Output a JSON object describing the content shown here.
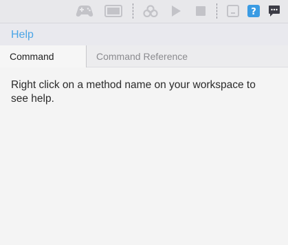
{
  "toolbar": {
    "icons": [
      "gamepad-icon",
      "window-icon",
      "blocks-icon",
      "play-icon",
      "stop-icon",
      "panel-icon",
      "help-icon",
      "chat-icon"
    ],
    "colors": {
      "disabled": "#c3c3c8",
      "active_blue": "#3b9be3",
      "dark": "#3c3c46"
    }
  },
  "panel": {
    "title": "Help",
    "title_color": "#4aa5e6"
  },
  "tabs": [
    {
      "label": "Command Help",
      "active": true
    },
    {
      "label": "Command Reference",
      "active": false
    }
  ],
  "content": {
    "message": "Right click on a method name on your workspace to see help."
  }
}
